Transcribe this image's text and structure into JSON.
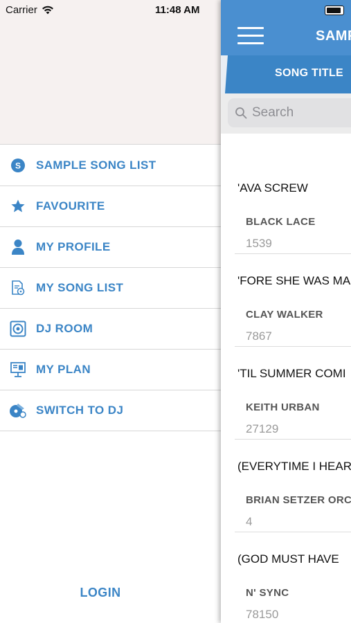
{
  "status_bar": {
    "carrier": "Carrier",
    "time": "11:48 AM"
  },
  "drawer": {
    "menu": [
      {
        "label": "SAMPLE SONG LIST",
        "icon": "sample-s-icon"
      },
      {
        "label": "FAVOURITE",
        "icon": "star-icon"
      },
      {
        "label": "MY PROFILE",
        "icon": "person-icon"
      },
      {
        "label": "MY SONG LIST",
        "icon": "music-list-icon"
      },
      {
        "label": "DJ ROOM",
        "icon": "speaker-icon"
      },
      {
        "label": "MY PLAN",
        "icon": "presentation-icon"
      },
      {
        "label": "SWITCH TO DJ",
        "icon": "dj-switch-icon"
      }
    ],
    "login_label": "LOGIN"
  },
  "panel": {
    "nav_title": "SAMPLE",
    "tab_label": "SONG TITLE",
    "search": {
      "placeholder": "Search"
    },
    "songs": [
      {
        "title": "'AVA SCREW",
        "artist": "BLACK LACE",
        "number": "1539"
      },
      {
        "title": "'FORE SHE WAS MA",
        "artist": "CLAY WALKER",
        "number": "7867"
      },
      {
        "title": "'TIL SUMMER COMI",
        "artist": "KEITH URBAN",
        "number": "27129"
      },
      {
        "title": "(EVERYTIME I HEAR",
        "artist": "BRIAN SETZER ORC",
        "number": "4"
      },
      {
        "title": "(GOD MUST HAVE",
        "artist": "N' SYNC",
        "number": "78150"
      }
    ]
  },
  "colors": {
    "accent": "#3b85c6",
    "nav_bar": "#4a8fd0",
    "drawer_header": "#f6f1f0"
  }
}
